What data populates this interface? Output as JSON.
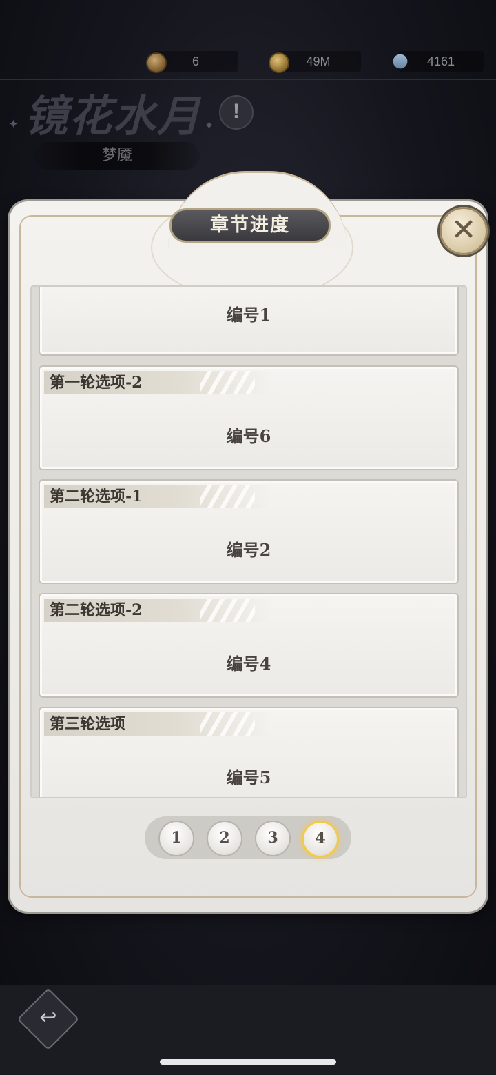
{
  "currencies": [
    {
      "icon": "medal-coin-icon",
      "value": "6"
    },
    {
      "icon": "gold-coin-icon",
      "value": "49M"
    },
    {
      "icon": "diamond-icon",
      "value": "4161"
    }
  ],
  "stage": {
    "title": "镜花水月",
    "info_symbol": "!",
    "subtitle": "梦魇"
  },
  "modal": {
    "title": "章节进度",
    "close_symbol": "✕",
    "entries": [
      {
        "tag": "",
        "label": "编号1"
      },
      {
        "tag": "第一轮选项-2",
        "label": "编号6"
      },
      {
        "tag": "第二轮选项-1",
        "label": "编号2"
      },
      {
        "tag": "第二轮选项-2",
        "label": "编号4"
      },
      {
        "tag": "第三轮选项",
        "label": "编号5"
      }
    ],
    "pages": [
      "1",
      "2",
      "3",
      "4"
    ],
    "active_page": "4"
  },
  "nav": {
    "back_symbol": "↩"
  },
  "colors": {
    "accent_gold": "#f2c94a",
    "panel_bg": "#f4f2ee",
    "title_pill": "#4a4a4e"
  }
}
